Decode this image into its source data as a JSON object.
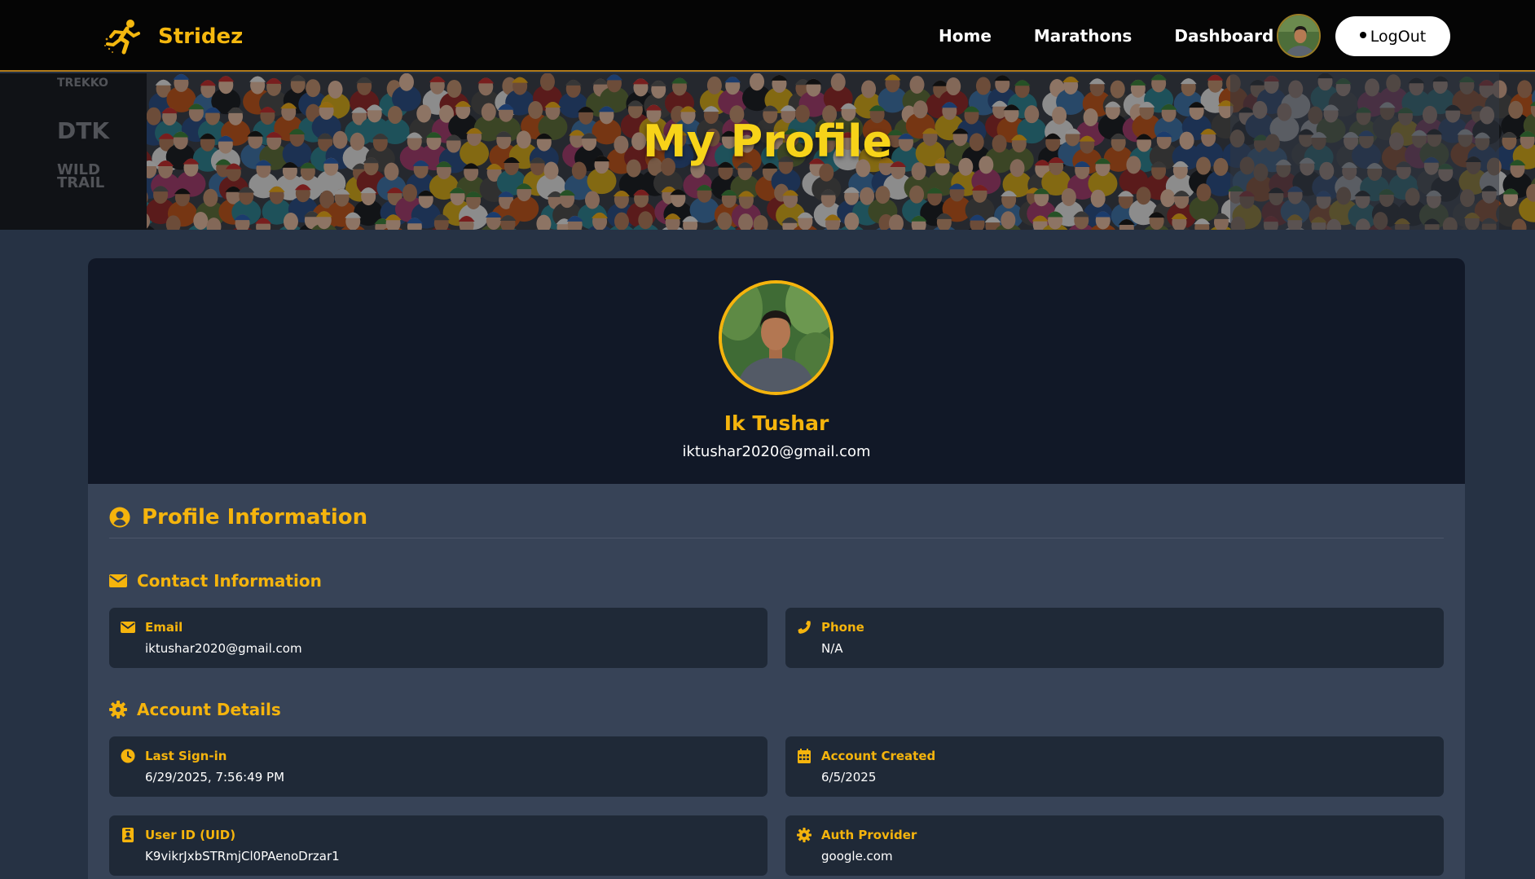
{
  "brand": {
    "name": "Stridez",
    "logo_icon": "running-man-icon"
  },
  "nav": {
    "links": [
      "Home",
      "Marathons",
      "Dashboard"
    ],
    "logout_label": "LogOut"
  },
  "hero": {
    "title": "My Profile"
  },
  "profile": {
    "name": "Ik Tushar",
    "email": "iktushar2020@gmail.com"
  },
  "section": {
    "title": "Profile Information",
    "icon": "user-circle-icon"
  },
  "contact": {
    "title": "Contact Information",
    "icon": "envelope-icon",
    "email": {
      "label": "Email",
      "value": "iktushar2020@gmail.com",
      "icon": "envelope-icon"
    },
    "phone": {
      "label": "Phone",
      "value": "N/A",
      "icon": "phone-icon"
    }
  },
  "account": {
    "title": "Account Details",
    "icon": "gear-icon",
    "last_signin": {
      "label": "Last Sign-in",
      "value": "6/29/2025, 7:56:49 PM",
      "icon": "clock-icon"
    },
    "created": {
      "label": "Account Created",
      "value": "6/5/2025",
      "icon": "calendar-icon"
    },
    "uid": {
      "label": "User ID (UID)",
      "value": "K9vikrJxbSTRmjCl0PAenoDrzar1",
      "icon": "id-badge-icon"
    },
    "provider": {
      "label": "Auth Provider",
      "value": "google.com",
      "icon": "gear-icon"
    }
  },
  "colors": {
    "accent": "#f5b40d",
    "hero_title": "#f7d319",
    "navbar_bg": "#050505",
    "page_bg": "#263244",
    "card_top_bg": "#111827",
    "card_body_bg": "#374357",
    "info_box_bg": "#1f2937"
  }
}
